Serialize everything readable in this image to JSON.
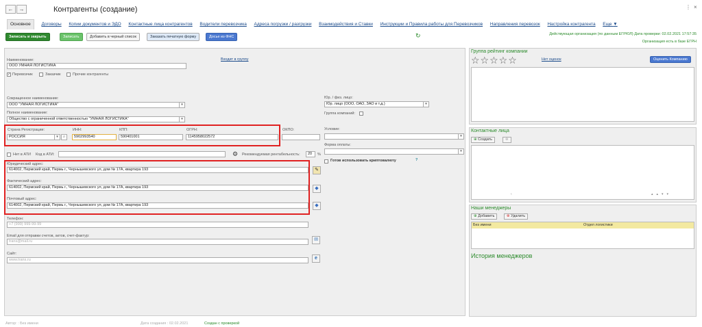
{
  "window": {
    "title": "Контрагенты (создание)",
    "menu_icon": "⋮",
    "close_icon": "×"
  },
  "tabs": [
    "Основное",
    "Договоры",
    "Копии документов и ЭДО",
    "Контактные лица контрагентов",
    "Водители перевозчика",
    "Адреса погрузки / разгрузки",
    "Взаимодействия и Ставки",
    "Инструкции и Правила работы для Перевозчиков",
    "Направления перевозок",
    "Настройка контрагента",
    "Еще"
  ],
  "toolbar": {
    "save_close": "Записать и закрыть",
    "save": "Записать",
    "blacklist": "Добавить в черный список",
    "print": "Заказать печатную форму",
    "fns": "Досье из ФНС",
    "refresh_icon": "↻",
    "egrul_line1": "Действующая организация (по данным ЕГРЮЛ) Дата проверки: 02.02.2021 17:57:35",
    "egrul_line2": "Организация есть в базе ЕГРН"
  },
  "form": {
    "name_label": "Наименование:",
    "name_value": "ООО УМНАЯ ЛОГИСТИКА",
    "group_link": "Входит в группу",
    "roles": [
      {
        "label": "Перевозчик",
        "checked": "✓"
      },
      {
        "label": "Заказчик",
        "checked": ""
      },
      {
        "label": "Прочие контрагенты",
        "checked": ""
      }
    ],
    "short_label": "Сокращенное наименование:",
    "short_value": "ООО \"УМНАЯ ЛОГИСТИКА\"",
    "full_label": "Полное наименование:",
    "full_value": "Общество с ограниченной ответственностью \"УМНАЯ ЛОГИСТИКА\"",
    "legal_label": "Юр. / физ. лицо:",
    "legal_value": "Юр. лицо (ООО, ОАО, ЗАО и т.д.)",
    "group_companies": "Группа компаний:",
    "country_label": "Страна Регистрации:",
    "country_value": "РОССИЯ",
    "inn_label": "ИНН:",
    "inn_value": "5902993540",
    "kpp_label": "КПП:",
    "kpp_value": "590401001",
    "ogrn_label": "ОГРН:",
    "ogrn_value": "1145958022572",
    "okpo_label": "ОКПО:",
    "condition_label": "Условие:",
    "payment_label": "Форма оплаты:",
    "no_ati": "Нет в АТИ",
    "ati_code": "Код в АТИ:",
    "profit_label": "Рекомендуемая рентабельность:",
    "profit_value": "20",
    "percent": "%",
    "crypto": "Готов использовать криптовалюту",
    "help": "?",
    "legal_addr_label": "Юридический адрес:",
    "legal_addr": "614002, Пермский край, Пермь г., Чернышевского ул, дом № 17А, квартира 193",
    "fact_addr_label": "Фактический адрес:",
    "fact_addr": "614002, Пермский край, Пермь г., Чернышевского ул, дом № 17А, квартира 193",
    "post_addr_label": "Почтовый адрес:",
    "post_addr": "614002, Пермский край, Пермь г., Чернышевского ул, дом № 17А, квартира 193",
    "phone_label": "Телефон:",
    "phone_ph": "+7 (999) 999-99-99",
    "email_label": "Email для отправки счетов, актов, счет-фактур:",
    "email_ph": "trans@mail.ru",
    "site_label": "Сайт:",
    "site_ph": "www.trans.ru"
  },
  "rating": {
    "title": "Группа рейтинг компании",
    "stars": "☆☆☆☆☆",
    "no_ratings": "Нет оценок",
    "rate_btn": "Оценить Компанию"
  },
  "contacts": {
    "title": "Контактные лица",
    "create": "Создать"
  },
  "managers": {
    "title": "Наши менеджеры",
    "add": "Добавить",
    "remove": "Удалить",
    "col1": "Без имени",
    "col2": "Отдел логистики"
  },
  "history": {
    "title": "История менеджеров"
  },
  "footer": {
    "author": "Автор: : Без имени",
    "date": "Дата создания : 02.02.2021",
    "status": "Создан с проверкой"
  }
}
